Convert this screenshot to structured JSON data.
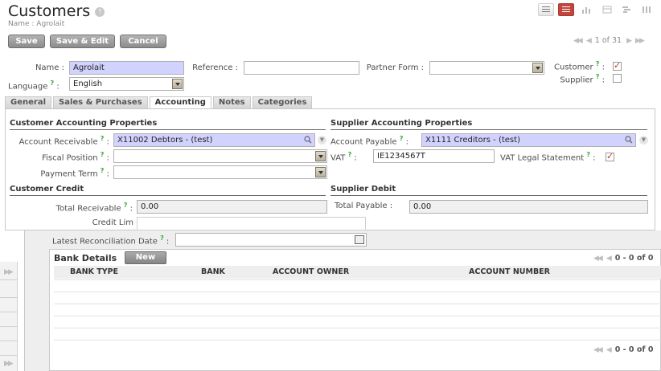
{
  "header": {
    "title": "Customers",
    "help": "?",
    "breadcrumb": "Name : Agrolait"
  },
  "toolbar": {
    "save": "Save",
    "save_edit": "Save & Edit",
    "cancel": "Cancel"
  },
  "pager": {
    "text": "1 of 31"
  },
  "form": {
    "name_label": "Name :",
    "name_value": "Agrolait",
    "reference_label": "Reference :",
    "reference_value": "",
    "partner_form_label": "Partner Form :",
    "partner_form_value": "",
    "customer_label": "Customer",
    "customer_checked": true,
    "supplier_label": "Supplier",
    "supplier_checked": false,
    "language_label": "Language",
    "language_value": "English"
  },
  "tabs": [
    {
      "label": "General",
      "active": false
    },
    {
      "label": "Sales & Purchases",
      "active": false
    },
    {
      "label": "Accounting",
      "active": true
    },
    {
      "label": "Notes",
      "active": false
    },
    {
      "label": "Categories",
      "active": false
    }
  ],
  "accounting": {
    "customer_title": "Customer Accounting Properties",
    "supplier_title": "Supplier Accounting Properties",
    "account_receivable_label": "Account Receivable",
    "account_receivable_value": "X11002 Debtors - (test)",
    "account_payable_label": "Account Payable",
    "account_payable_value": "X1111 Creditors - (test)",
    "fiscal_position_label": "Fiscal Position",
    "vat_label": "VAT",
    "vat_value": "IE1234567T",
    "vat_legal_label": "VAT Legal Statement",
    "vat_legal_checked": true,
    "payment_term_label": "Payment Term",
    "customer_credit_title": "Customer Credit",
    "supplier_debit_title": "Supplier Debit",
    "total_receivable_label": "Total Receivable",
    "total_receivable_value": "0.00",
    "total_payable_label": "Total Payable :",
    "total_payable_value": "0.00",
    "credit_limit_label": "Credit Lim",
    "latest_reconciliation_label": "Latest Reconciliation Date"
  },
  "bank": {
    "title": "Bank Details",
    "new": "New",
    "pager": "0 - 0 of 0",
    "columns": [
      "BANK TYPE",
      "BANK",
      "ACCOUNT OWNER",
      "ACCOUNT NUMBER"
    ]
  },
  "colors": {
    "required_bg": "#d2d2ff",
    "active_view": "#c2463e",
    "help_green": "#3aa63a"
  }
}
